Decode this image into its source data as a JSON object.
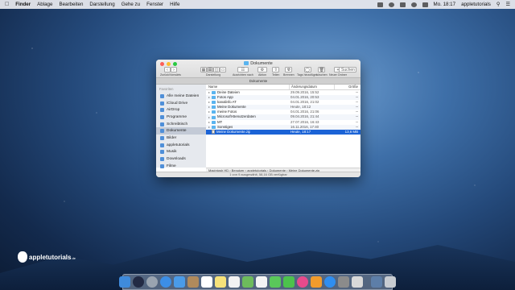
{
  "menubar": {
    "app": "Finder",
    "items": [
      "Ablage",
      "Bearbeiten",
      "Darstellung",
      "Gehe zu",
      "Fenster",
      "Hilfe"
    ],
    "clock": "Mo. 18:17",
    "user": "appletutorials"
  },
  "window": {
    "title": "Dokumente",
    "nav_label": "Zurück/Vorwärts",
    "toolbar": {
      "view_label": "Darstellung",
      "arrange_label": "Ausrichten nach",
      "action_label": "Aktion",
      "share_label": "Teilen",
      "burn_label": "Brennen",
      "tags_label": "Tags hinzufügen",
      "delete_label": "Löschen",
      "newfolder_label": "Neuer Ordner",
      "search_placeholder": "Suchen"
    },
    "pathbar_title": "Dokumente"
  },
  "sidebar": {
    "header": "Favoriten",
    "items": [
      {
        "label": "Alle meine Dateien",
        "icon": "all-files-icon"
      },
      {
        "label": "iCloud Drive",
        "icon": "cloud-icon"
      },
      {
        "label": "AirDrop",
        "icon": "airdrop-icon"
      },
      {
        "label": "Programme",
        "icon": "apps-icon"
      },
      {
        "label": "Schreibtisch",
        "icon": "desktop-icon"
      },
      {
        "label": "Dokumente",
        "icon": "documents-icon",
        "selected": true
      },
      {
        "label": "Bilder",
        "icon": "pictures-icon"
      },
      {
        "label": "appletutorials",
        "icon": "home-icon"
      },
      {
        "label": "Musik",
        "icon": "music-icon"
      },
      {
        "label": "Downloads",
        "icon": "downloads-icon"
      },
      {
        "label": "Filme",
        "icon": "movies-icon"
      }
    ]
  },
  "columns": {
    "name": "Name",
    "date": "Änderungsdatum",
    "size": "Größe"
  },
  "files": [
    {
      "name": "Deine Dateien",
      "date": "29.09.2016, 15:52",
      "size": "--",
      "kind": "folder"
    },
    {
      "name": "Fotos App",
      "date": "04.01.2016, 20:53",
      "size": "--",
      "kind": "folder"
    },
    {
      "name": "kanalinfo AT",
      "date": "04.01.2016, 21:02",
      "size": "--",
      "kind": "folder"
    },
    {
      "name": "Meine Dokumente",
      "date": "Heute, 18:12",
      "size": "--",
      "kind": "folder"
    },
    {
      "name": "meine Fotos",
      "date": "04.01.2016, 21:06",
      "size": "--",
      "kind": "folder"
    },
    {
      "name": "Microsoft-Benutzerdaten",
      "date": "09.04.2016, 21:44",
      "size": "--",
      "kind": "folder"
    },
    {
      "name": "MT",
      "date": "27.07.2016, 16:43",
      "size": "--",
      "kind": "folder"
    },
    {
      "name": "Sonstiges",
      "date": "16.11.2016, 17:40",
      "size": "--",
      "kind": "folder"
    },
    {
      "name": "Meine Dokumente.zip",
      "date": "Heute, 18:17",
      "size": "13,6 MB",
      "kind": "zip",
      "selected": true
    }
  ],
  "path": "Macintosh HD  ›  Benutzer  ›  appletutorials  ›  Dokumente  ›  Meine Dokumente.zip",
  "status": "1 von 9 ausgewählt, 58,16 GB verfügbar",
  "dock": {
    "icons": [
      "finder-icon",
      "siri-icon",
      "launchpad-icon",
      "safari-icon",
      "mail-icon",
      "contacts-icon",
      "calendar-icon",
      "notes-icon",
      "reminders-icon",
      "maps-icon",
      "photos-icon",
      "messages-icon",
      "facetime-icon",
      "itunes-icon",
      "ibooks-icon",
      "appstore-icon",
      "preferences-icon",
      "chess-icon",
      "downloads-stack-icon",
      "trash-icon"
    ],
    "colors": [
      "#3f8bdc",
      "#222a44",
      "#9aa4b0",
      "#3c8ee6",
      "#4a9be8",
      "#b08a5c",
      "#ffffff",
      "#f7e27a",
      "#f2f2f2",
      "#6dbb5c",
      "#f4f4f4",
      "#5ac85a",
      "#4cc24c",
      "#e64a8c",
      "#f19b2c",
      "#2f8ef0",
      "#8b8b8b",
      "#d9d9d9",
      "#5d7ea8",
      "#c8ccd2"
    ]
  },
  "watermark": {
    "text": "appletutorials",
    "suffix": ".de"
  }
}
